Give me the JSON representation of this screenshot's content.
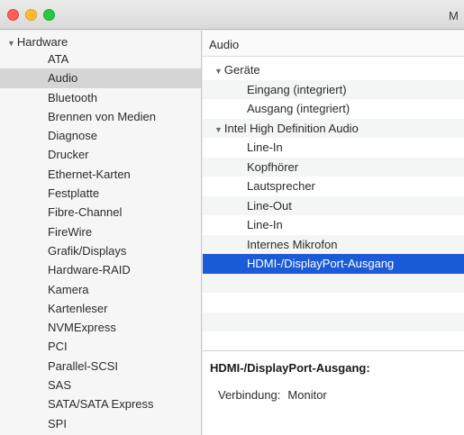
{
  "window": {
    "title": "M"
  },
  "sidebar": {
    "section_label": "Hardware",
    "items": [
      "ATA",
      "Audio",
      "Bluetooth",
      "Brennen von Medien",
      "Diagnose",
      "Drucker",
      "Ethernet-Karten",
      "Festplatte",
      "Fibre-Channel",
      "FireWire",
      "Grafik/Displays",
      "Hardware-RAID",
      "Kamera",
      "Kartenleser",
      "NVMExpress",
      "PCI",
      "Parallel-SCSI",
      "SAS",
      "SATA/SATA Express",
      "SPI"
    ],
    "selected": "Audio"
  },
  "main": {
    "header": "Audio",
    "tree": [
      {
        "label": "Geräte",
        "kind": "group"
      },
      {
        "label": "Eingang (integriert)",
        "kind": "child"
      },
      {
        "label": "Ausgang (integriert)",
        "kind": "child"
      },
      {
        "label": "Intel High Definition Audio",
        "kind": "group"
      },
      {
        "label": "Line-In",
        "kind": "child"
      },
      {
        "label": "Kopfhörer",
        "kind": "child"
      },
      {
        "label": "Lautsprecher",
        "kind": "child"
      },
      {
        "label": "Line-Out",
        "kind": "child"
      },
      {
        "label": "Line-In",
        "kind": "child"
      },
      {
        "label": "Internes Mikrofon",
        "kind": "child"
      },
      {
        "label": "HDMI-/DisplayPort-Ausgang",
        "kind": "child",
        "selected": true
      }
    ],
    "detail": {
      "title": "HDMI-/DisplayPort-Ausgang:",
      "field_label": "Verbindung:",
      "field_value": "Monitor"
    }
  },
  "colors": {
    "selection": "#1b5bd7",
    "sidebar_selection": "#d5d5d5"
  }
}
